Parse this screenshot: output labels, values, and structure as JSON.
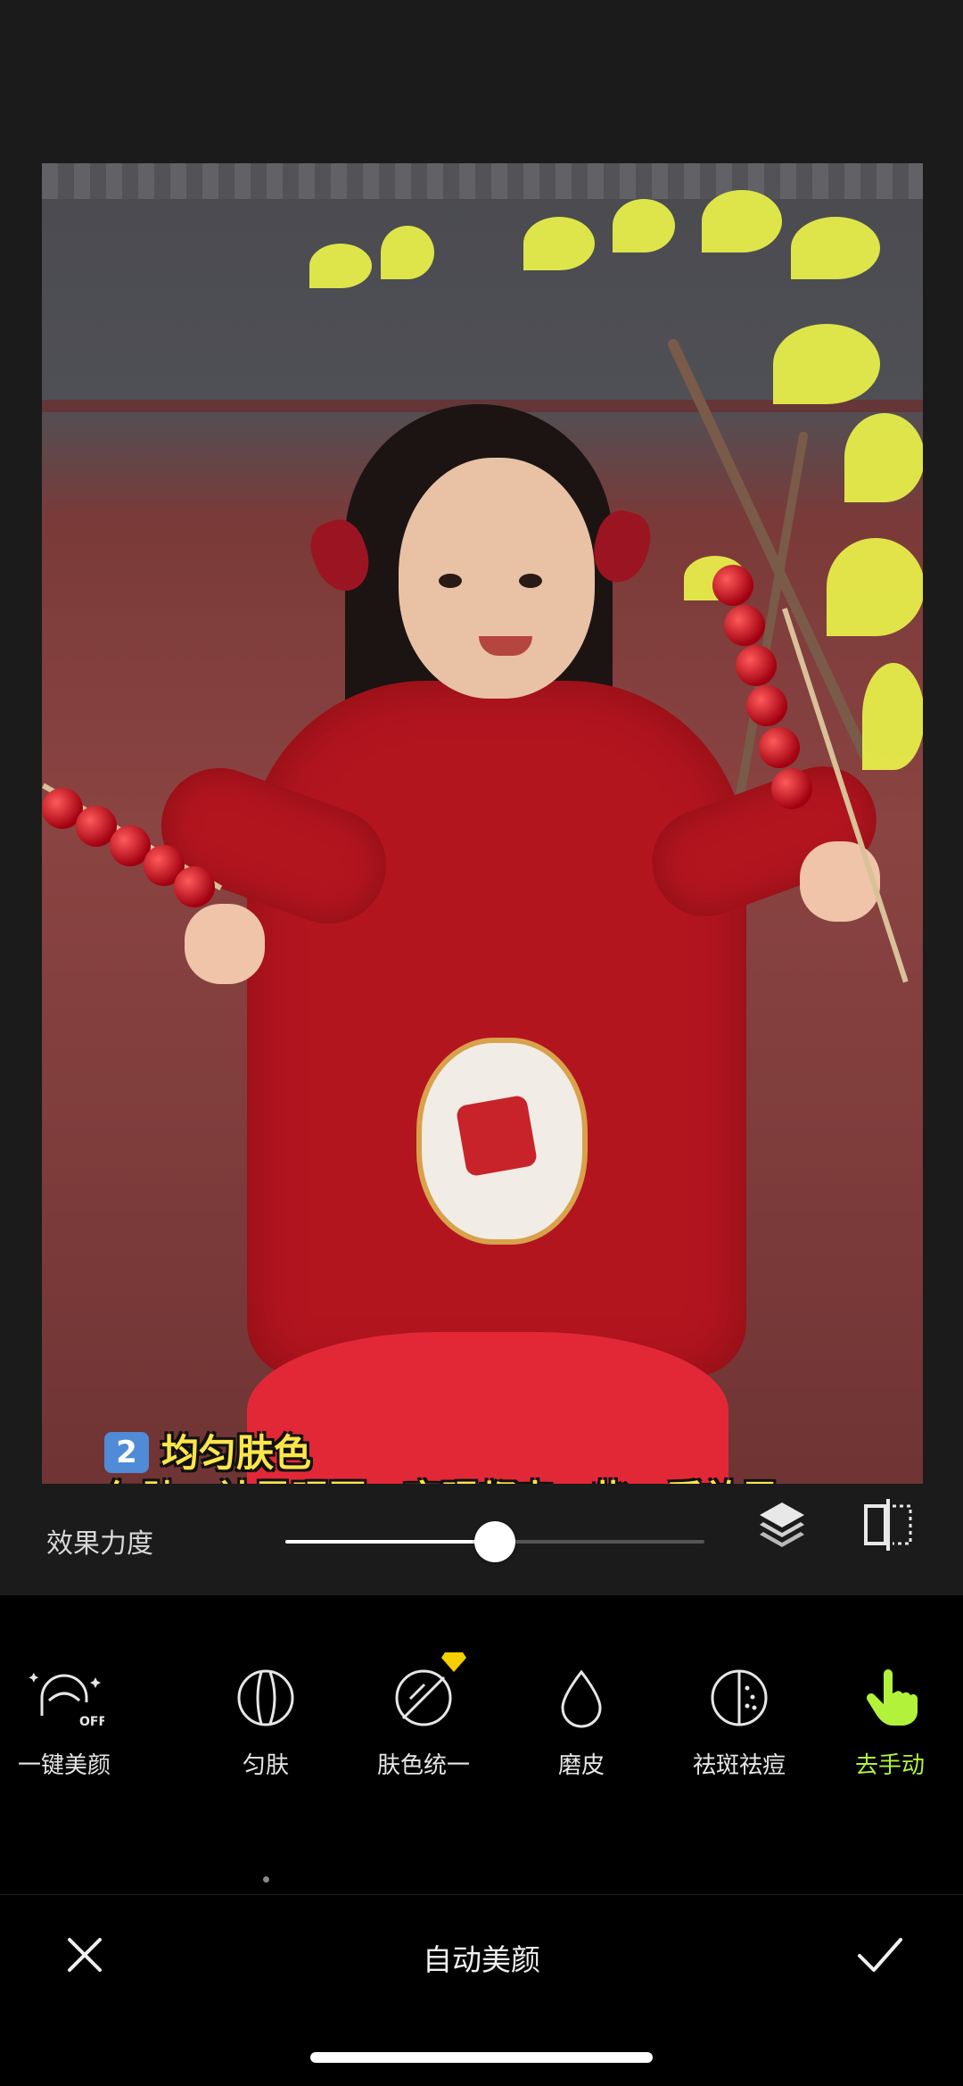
{
  "photo": {
    "caption_number": "2",
    "caption_line1": "均匀肤色",
    "caption_line2": "匀肤、祛黑眼圈、亮眼都来一些，看效果"
  },
  "strength": {
    "label": "效果力度",
    "value_fraction": 0.5
  },
  "tools": [
    {
      "label": "一键美颜",
      "icon": "face-beauty-off-icon",
      "badge": "OFF"
    },
    {
      "label": "匀肤",
      "icon": "circle-lines-icon",
      "selected_dot": true
    },
    {
      "label": "肤色统一",
      "icon": "circle-slash-icon",
      "premium": true
    },
    {
      "label": "磨皮",
      "icon": "drop-icon"
    },
    {
      "label": "祛斑祛痘",
      "icon": "circle-dots-icon"
    },
    {
      "label": "去手动",
      "icon": "hand-pointer-icon",
      "active": true
    }
  ],
  "bottom": {
    "title": "自动美颜"
  },
  "colors": {
    "accent": "#b2f23a",
    "premium_gem": "#f5d000",
    "caption_text": "#ffe54a"
  }
}
